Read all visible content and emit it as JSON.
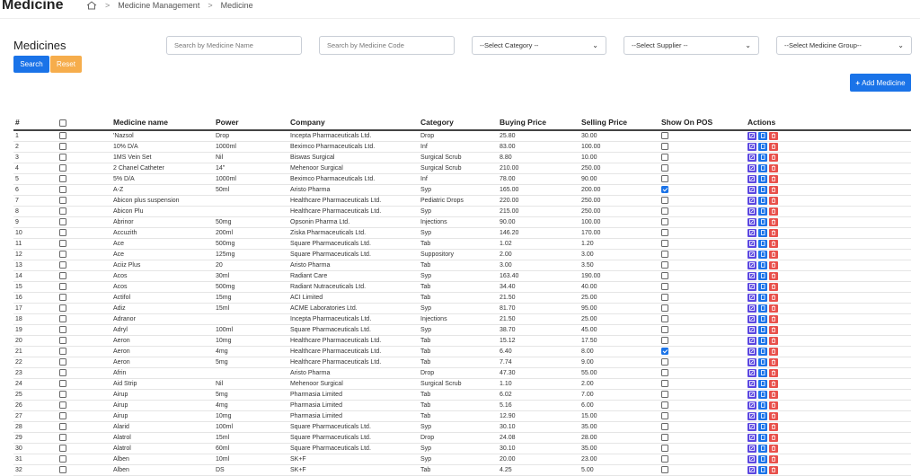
{
  "header": {
    "app_title": "Medicine",
    "breadcrumb": [
      "Medicine Management",
      "Medicine"
    ]
  },
  "page": {
    "title": "Medicines"
  },
  "filters": {
    "search_name_placeholder": "Search by Medicine Name",
    "search_code_placeholder": "Search by Medicine Code",
    "category_selected": "--Select Category --",
    "supplier_selected": "--Select Supplier --",
    "group_selected": "--Select Medicine Group--",
    "search_label": "Search",
    "reset_label": "Reset"
  },
  "add_label": "Add Medicine",
  "table": {
    "columns": [
      "#",
      "",
      "Medicine name",
      "Power",
      "Company",
      "Category",
      "Buying Price",
      "Selling Price",
      "Show On POS",
      "Actions"
    ],
    "rows": [
      {
        "n": "1",
        "name": "'Nazsol",
        "power": "Drop",
        "company": "Incepta Pharmaceuticals Ltd.",
        "category": "Drop",
        "buy": "25.80",
        "sell": "30.00",
        "pos": false
      },
      {
        "n": "2",
        "name": "10% D/A",
        "power": "1000ml",
        "company": "Beximco Pharmaceuticals Ltd.",
        "category": "Inf",
        "buy": "83.00",
        "sell": "100.00",
        "pos": false
      },
      {
        "n": "3",
        "name": "1MS Vein Set",
        "power": "Nil",
        "company": "Biswas Surgical",
        "category": "Surgical Scrub",
        "buy": "8.80",
        "sell": "10.00",
        "pos": false
      },
      {
        "n": "4",
        "name": "2 Chanel Catheter",
        "power": "14\"",
        "company": "Mehenoor Surgical",
        "category": "Surgical Scrub",
        "buy": "210.00",
        "sell": "250.00",
        "pos": false
      },
      {
        "n": "5",
        "name": "5% D/A",
        "power": "1000ml",
        "company": "Beximco Pharmaceuticals Ltd.",
        "category": "Inf",
        "buy": "78.00",
        "sell": "90.00",
        "pos": false
      },
      {
        "n": "6",
        "name": "A-Z",
        "power": "50ml",
        "company": "Aristo Pharma",
        "category": "Syp",
        "buy": "165.00",
        "sell": "200.00",
        "pos": true
      },
      {
        "n": "7",
        "name": "Abicon plus suspension",
        "power": "",
        "company": "Healthcare Pharmaceuticals Ltd.",
        "category": "Pediatric Drops",
        "buy": "220.00",
        "sell": "250.00",
        "pos": false
      },
      {
        "n": "8",
        "name": "Abicon Plu",
        "power": "",
        "company": "Healthcare Pharmaceuticals Ltd.",
        "category": "Syp",
        "buy": "215.00",
        "sell": "250.00",
        "pos": false
      },
      {
        "n": "9",
        "name": "Abrinor",
        "power": "50mg",
        "company": "Opsonin Pharma Ltd.",
        "category": "Injections",
        "buy": "90.00",
        "sell": "100.00",
        "pos": false
      },
      {
        "n": "10",
        "name": "Accuzith",
        "power": "200ml",
        "company": "Ziska Pharmaceuticals Ltd.",
        "category": "Syp",
        "buy": "146.20",
        "sell": "170.00",
        "pos": false
      },
      {
        "n": "11",
        "name": "Ace",
        "power": "500mg",
        "company": "Square Pharmaceuticals Ltd.",
        "category": "Tab",
        "buy": "1.02",
        "sell": "1.20",
        "pos": false
      },
      {
        "n": "12",
        "name": "Ace",
        "power": "125mg",
        "company": "Square Pharmaceuticals Ltd.",
        "category": "Suppository",
        "buy": "2.00",
        "sell": "3.00",
        "pos": false
      },
      {
        "n": "13",
        "name": "Aciiz Plus",
        "power": "20",
        "company": "Aristo Pharma",
        "category": "Tab",
        "buy": "3.00",
        "sell": "3.50",
        "pos": false
      },
      {
        "n": "14",
        "name": "Acos",
        "power": "30ml",
        "company": "Radiant Care",
        "category": "Syp",
        "buy": "163.40",
        "sell": "190.00",
        "pos": false
      },
      {
        "n": "15",
        "name": "Acos",
        "power": "500mg",
        "company": "Radiant Nutraceuticals Ltd.",
        "category": "Tab",
        "buy": "34.40",
        "sell": "40.00",
        "pos": false
      },
      {
        "n": "16",
        "name": "Actifol",
        "power": "15mg",
        "company": "ACI Limited",
        "category": "Tab",
        "buy": "21.50",
        "sell": "25.00",
        "pos": false
      },
      {
        "n": "17",
        "name": "Adiz",
        "power": "15ml",
        "company": "ACME Laboratories Ltd.",
        "category": "Syp",
        "buy": "81.70",
        "sell": "95.00",
        "pos": false
      },
      {
        "n": "18",
        "name": "Adranor",
        "power": "",
        "company": "Incepta Pharmaceuticals Ltd.",
        "category": "Injections",
        "buy": "21.50",
        "sell": "25.00",
        "pos": false
      },
      {
        "n": "19",
        "name": "Adryl",
        "power": "100ml",
        "company": "Square Pharmaceuticals Ltd.",
        "category": "Syp",
        "buy": "38.70",
        "sell": "45.00",
        "pos": false
      },
      {
        "n": "20",
        "name": "Aeron",
        "power": "10mg",
        "company": "Healthcare Pharmaceuticals Ltd.",
        "category": "Tab",
        "buy": "15.12",
        "sell": "17.50",
        "pos": false
      },
      {
        "n": "21",
        "name": "Aeron",
        "power": "4mg",
        "company": "Healthcare Pharmaceuticals Ltd.",
        "category": "Tab",
        "buy": "6.40",
        "sell": "8.00",
        "pos": true
      },
      {
        "n": "22",
        "name": "Aeron",
        "power": "5mg",
        "company": "Healthcare Pharmaceuticals Ltd.",
        "category": "Tab",
        "buy": "7.74",
        "sell": "9.00",
        "pos": false
      },
      {
        "n": "23",
        "name": "Afrin",
        "power": "",
        "company": "Aristo Pharma",
        "category": "Drop",
        "buy": "47.30",
        "sell": "55.00",
        "pos": false
      },
      {
        "n": "24",
        "name": "Aid Strip",
        "power": "Nil",
        "company": "Mehenoor Surgical",
        "category": "Surgical Scrub",
        "buy": "1.10",
        "sell": "2.00",
        "pos": false
      },
      {
        "n": "25",
        "name": "Airup",
        "power": "5mg",
        "company": "Pharmasia Limited",
        "category": "Tab",
        "buy": "6.02",
        "sell": "7.00",
        "pos": false
      },
      {
        "n": "26",
        "name": "Airup",
        "power": "4mg",
        "company": "Pharmasia Limited",
        "category": "Tab",
        "buy": "5.16",
        "sell": "6.00",
        "pos": false
      },
      {
        "n": "27",
        "name": "Airup",
        "power": "10mg",
        "company": "Pharmasia Limited",
        "category": "Tab",
        "buy": "12.90",
        "sell": "15.00",
        "pos": false
      },
      {
        "n": "28",
        "name": "Alarid",
        "power": "100ml",
        "company": "Square Pharmaceuticals Ltd.",
        "category": "Syp",
        "buy": "30.10",
        "sell": "35.00",
        "pos": false
      },
      {
        "n": "29",
        "name": "Alatrol",
        "power": "15ml",
        "company": "Square Pharmaceuticals Ltd.",
        "category": "Drop",
        "buy": "24.08",
        "sell": "28.00",
        "pos": false
      },
      {
        "n": "30",
        "name": "Alatrol",
        "power": "60ml",
        "company": "Square Pharmaceuticals Ltd.",
        "category": "Syp",
        "buy": "30.10",
        "sell": "35.00",
        "pos": false
      },
      {
        "n": "31",
        "name": "Alben",
        "power": "10ml",
        "company": "SK+F",
        "category": "Syp",
        "buy": "20.00",
        "sell": "23.00",
        "pos": false
      },
      {
        "n": "32",
        "name": "Alben",
        "power": "DS",
        "company": "SK+F",
        "category": "Tab",
        "buy": "4.25",
        "sell": "5.00",
        "pos": false
      }
    ]
  }
}
